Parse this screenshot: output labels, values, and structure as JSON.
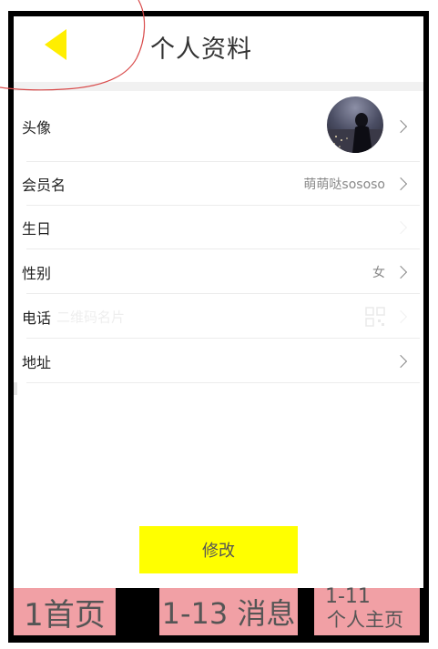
{
  "header": {
    "title": "个人资料",
    "back_icon": "back-arrow-icon",
    "back_color": "#ffee00"
  },
  "rows": [
    {
      "label": "头像",
      "value": "",
      "kind": "avatar"
    },
    {
      "label": "会员名",
      "value": "萌萌哒sososo"
    },
    {
      "label": "生日",
      "value": ""
    },
    {
      "label": "性别",
      "value": "女"
    },
    {
      "label": "电话",
      "faint_text": "二维码名片",
      "value": ""
    },
    {
      "label": "地址",
      "value": ""
    }
  ],
  "button": {
    "label": "修改",
    "color": "#ffff00"
  },
  "tabs": {
    "home": "1首页",
    "messages": "1-13 消息",
    "profile_line1": "1-11",
    "profile_line2": "个人主页",
    "color": "#f1a0a5"
  }
}
